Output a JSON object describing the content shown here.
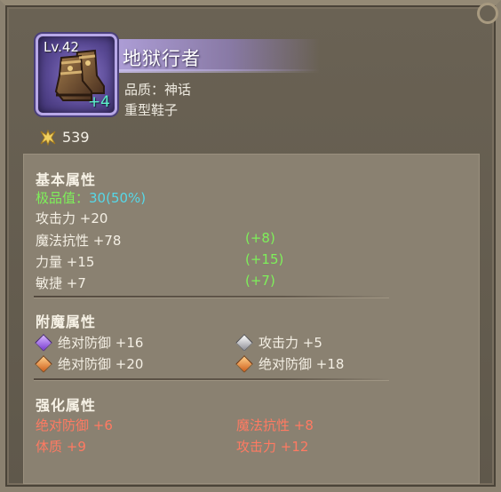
{
  "item": {
    "level": "Lv.42",
    "plus": "+4",
    "name": "地狱行者",
    "quality": "品质：神话",
    "type": "重型鞋子",
    "icon": "boots-icon"
  },
  "price": {
    "icon": "gold-icon",
    "value": "539"
  },
  "base": {
    "title": "基本属性",
    "quality_label": "极品值：",
    "quality_value": "30(50%)",
    "stats": [
      {
        "label": "攻击力 +20",
        "bonus": ""
      },
      {
        "label": "魔法抗性 +78",
        "bonus": "(+8)"
      },
      {
        "label": "力量 +15",
        "bonus": "(+15)"
      },
      {
        "label": "敏捷 +7",
        "bonus": "(+7)"
      }
    ]
  },
  "enchant": {
    "title": "附魔属性",
    "items": [
      {
        "gem": "purple",
        "label": "绝对防御 +16"
      },
      {
        "gem": "grey",
        "label": "攻击力 +5"
      },
      {
        "gem": "orange",
        "label": "绝对防御 +20"
      },
      {
        "gem": "orange",
        "label": "绝对防御 +18"
      }
    ]
  },
  "enhance": {
    "title": "强化属性",
    "items": [
      "绝对防御 +6",
      "魔法抗性 +8",
      "体质 +9",
      "攻击力 +12"
    ]
  },
  "colors": {
    "quality_green": "#7ef05a",
    "quality_cyan": "#56d8e8",
    "enhance_red": "#ff7a62",
    "icon_frame": "#b8a8e8"
  }
}
